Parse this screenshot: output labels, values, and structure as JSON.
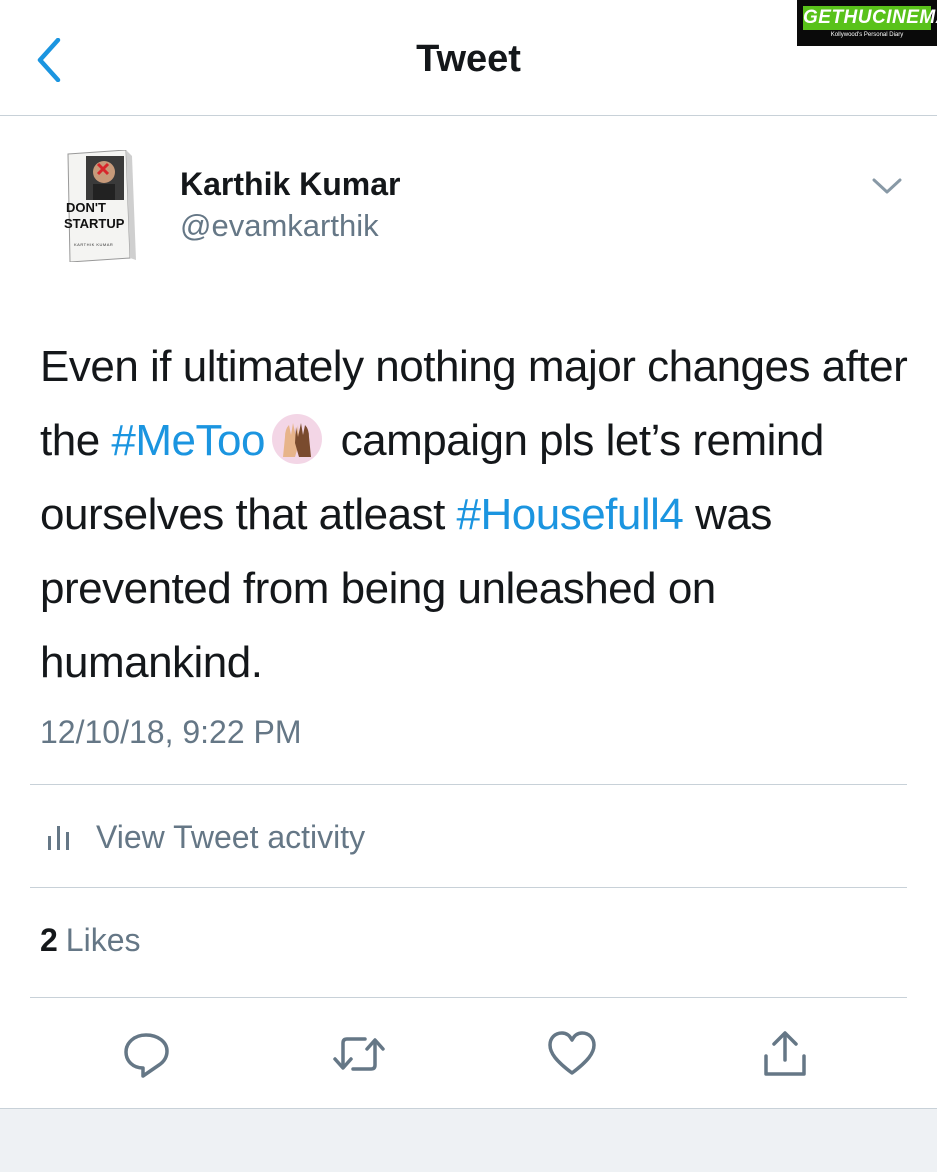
{
  "header": {
    "title": "Tweet",
    "back_icon": "chevron-left-icon"
  },
  "watermark": {
    "text": "GETHUCINEMA",
    "subtext": "Kollywood's Personal Diary"
  },
  "author": {
    "name": "Karthik Kumar",
    "handle": "@evamkarthik",
    "avatar_text_1": "DON'T",
    "avatar_text_2": "STARTUP",
    "avatar_text_3": "KARTHIK KUMAR"
  },
  "tweet": {
    "text_1": "Even if ultimately nothing major changes after the ",
    "hashtag_1": "#MeToo",
    "emoji": "raised-hands-emoji",
    "text_2": " campaign pls let’s remind ourselves that atleast ",
    "hashtag_2": "#Housefull4",
    "text_3": " was prevented from being unleashed on humankind.",
    "timestamp": "12/10/18, 9:22 PM"
  },
  "activity": {
    "label": "View Tweet activity"
  },
  "likes": {
    "count": "2",
    "label": "Likes"
  },
  "actions": [
    "reply-icon",
    "retweet-icon",
    "like-icon",
    "share-icon"
  ],
  "colors": {
    "accent": "#1b95e0",
    "secondary_text": "#657786",
    "divider": "#c8d1d8",
    "watermark_green": "#59c21a"
  }
}
